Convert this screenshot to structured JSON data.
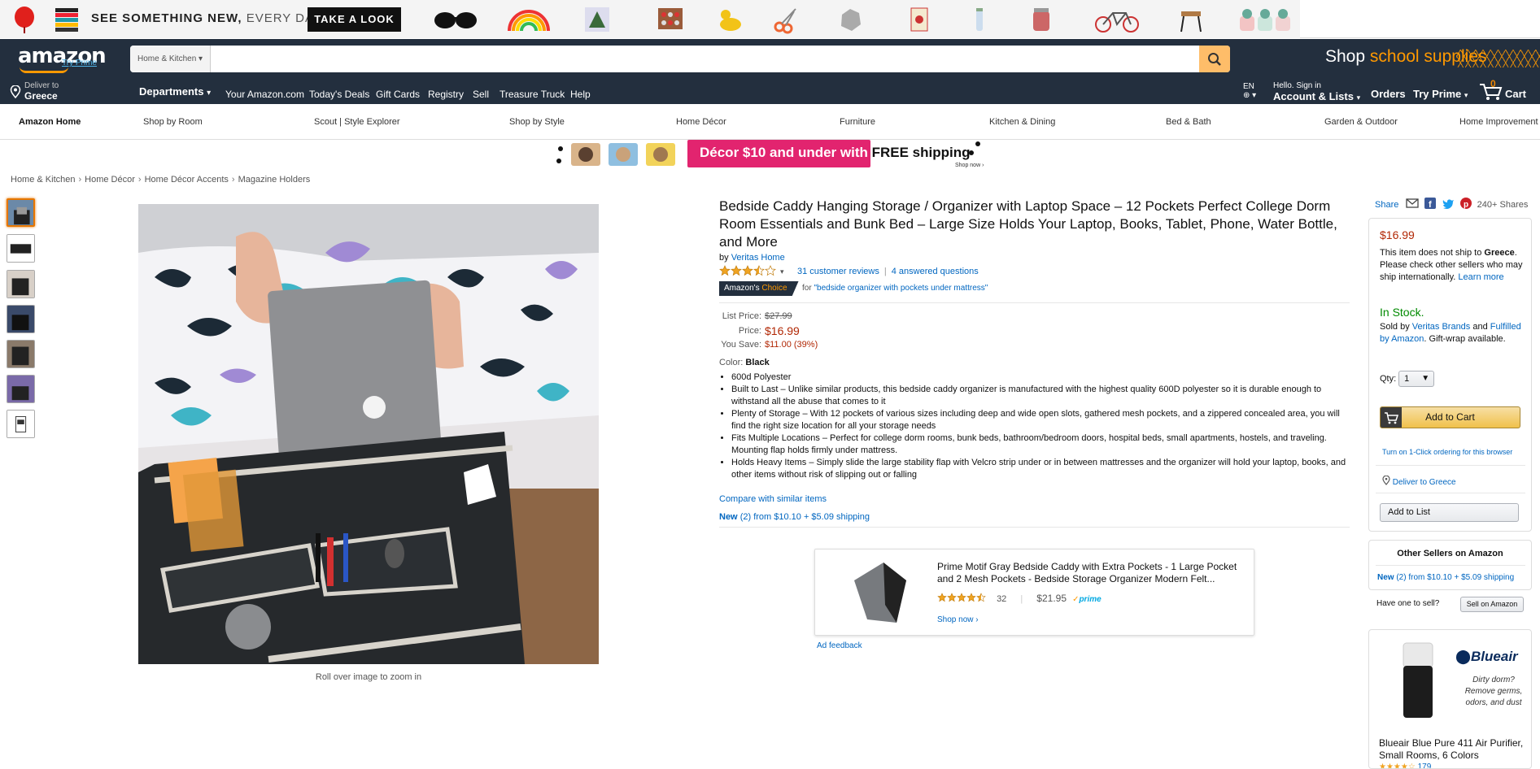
{
  "promo": {
    "headline_bold": "SEE SOMETHING NEW,",
    "headline_light": "EVERY DAY.",
    "button": "TAKE A LOOK"
  },
  "header": {
    "logo": "amazon",
    "try_prime": "Try Prime",
    "search_dept": "Home & Kitchen",
    "search_placeholder": "",
    "school_prefix": "Shop",
    "school_accent": "school supplies",
    "deliver_small": "Deliver to",
    "deliver_big": "Greece",
    "departments": "Departments",
    "nav_links": [
      "Your Amazon.com",
      "Today's Deals",
      "Gift Cards",
      "Registry",
      "Sell",
      "Treasure Truck",
      "Help"
    ],
    "lang": "EN",
    "hello": "Hello. Sign in",
    "account": "Account & Lists",
    "orders": "Orders",
    "try_prime_menu": "Try Prime",
    "cart_count": "0",
    "cart": "Cart"
  },
  "subnav": [
    "Amazon Home",
    "Shop by Room",
    "Scout | Style Explorer",
    "Shop by Style",
    "Home Décor",
    "Furniture",
    "Kitchen & Dining",
    "Bed & Bath",
    "Garden & Outdoor",
    "Home Improvement"
  ],
  "banner": {
    "text_pink": "Décor $10 and under with",
    "text_dark": "FREE shipping",
    "shop_now": "Shop now ›"
  },
  "breadcrumb": [
    "Home & Kitchen",
    "Home Décor",
    "Home Décor Accents",
    "Magazine Holders"
  ],
  "gallery": {
    "zoom_hint": "Roll over image to zoom in",
    "thumb_count": 7
  },
  "product": {
    "title": "Bedside Caddy Hanging Storage / Organizer with Laptop Space – 12 Pockets Perfect College Dorm Room Essentials and Bunk Bed – Large Size Holds Your Laptop, Books, Tablet, Phone, Water Bottle, and More",
    "by": "by",
    "brand": "Veritas Home",
    "rating": 3.5,
    "reviews": "31 customer reviews",
    "questions": "4 answered questions",
    "choice_left": "Amazon's",
    "choice_right": "Choice",
    "choice_for": "for",
    "choice_query": "\"bedside organizer with pockets under mattress\"",
    "list_price_label": "List Price:",
    "list_price": "$27.99",
    "price_label": "Price:",
    "price": "$16.99",
    "save_label": "You Save:",
    "save": "$11.00 (39%)",
    "color_label": "Color:",
    "color": "Black",
    "bullets": [
      "600d Polyester",
      "Built to Last – Unlike similar products, this bedside caddy organizer is manufactured with the highest quality 600D polyester so it is durable enough to withstand all the abuse that comes to it",
      "Plenty of Storage – With 12 pockets of various sizes including deep and wide open slots, gathered mesh pockets, and a zippered concealed area, you will find the right size location for all your storage needs",
      "Fits Multiple Locations – Perfect for college dorm rooms, bunk beds, bathroom/bedroom doors, hospital beds, small apartments, hostels, and traveling. Mounting flap holds firmly under mattress.",
      "Holds Heavy Items – Simply slide the large stability flap with Velcro strip under or in between mattresses and the organizer will hold your laptop, books, and other items without risk of slipping out or falling"
    ],
    "compare": "Compare with similar items",
    "new_label": "New",
    "new_offer": "(2) from $10.10 + $5.09 shipping"
  },
  "ad": {
    "title": "Prime Motif Gray Bedside Caddy with Extra Pockets - 1 Large Pocket and 2 Mesh Pockets - Bedside Storage Organizer Modern Felt...",
    "rating": 4.5,
    "reviews": "32",
    "price": "$21.95",
    "prime": "prime",
    "shop_now": "Shop now ›",
    "feedback": "Ad feedback"
  },
  "buybox": {
    "share": "Share",
    "shares": "240+ Shares",
    "price": "$16.99",
    "ship_text_1": "This item does not ship to",
    "ship_country": "Greece",
    "ship_text_2": ". Please check other sellers who may ship internationally.",
    "learn_more": "Learn more",
    "stock": "In Stock.",
    "sold_by": "Sold by",
    "seller": "Veritas Brands",
    "and": "and",
    "fulfilled": "Fulfilled by Amazon",
    "gift": ". Gift-wrap available.",
    "qty_label": "Qty:",
    "qty": "1",
    "add_to_cart": "Add to Cart",
    "one_click": "Turn on 1-Click ordering for this browser",
    "deliver_to": "Deliver to Greece",
    "add_to_list": "Add to List"
  },
  "other_sellers": {
    "title": "Other Sellers on Amazon",
    "new_label": "New",
    "offer": "(2) from $10.10 + $5.09 shipping",
    "have_one": "Have one to sell?",
    "sell_button": "Sell on Amazon"
  },
  "sponsor": {
    "brand": "Blueair",
    "tagline": "Dirty dorm? Remove germs, odors, and dust",
    "title": "Blueair Blue Pure 411 Air Purifier, Small Rooms, 6 Colors",
    "reviews": "179"
  },
  "colors": {
    "header_bg": "#232f3e",
    "accent": "#ff9900",
    "link": "#0066c0",
    "price": "#b12704",
    "stock": "#008a00"
  }
}
